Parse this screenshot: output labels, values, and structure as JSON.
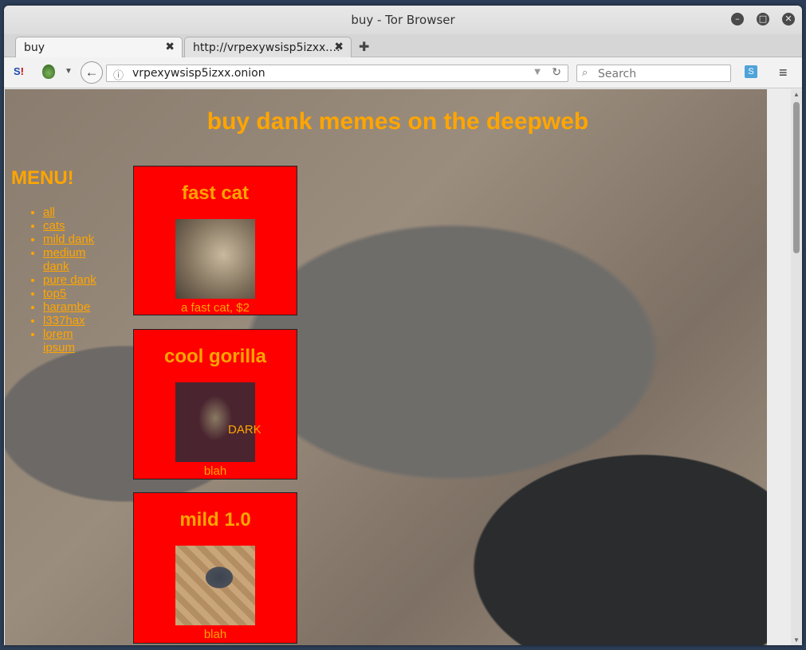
{
  "window": {
    "title": "buy - Tor Browser"
  },
  "tabs": [
    {
      "label": "buy",
      "close": "✖"
    },
    {
      "label": "http://vrpexywsisp5izxx.…",
      "close": "✖"
    }
  ],
  "toolbar": {
    "url": "vrpexywsisp5izxx.onion",
    "search_placeholder": "Search"
  },
  "page": {
    "title": "buy dank memes on the deepweb",
    "menu_heading": "MENU!",
    "menu": [
      "all",
      "cats",
      "mild dank",
      "medium dank",
      "pure dank",
      "top5",
      "harambe",
      "l337hax",
      "lorem ipsum"
    ],
    "products": [
      {
        "name": "fast cat",
        "caption": "a fast cat, $2",
        "overlay": ""
      },
      {
        "name": "cool gorilla",
        "caption": "blah",
        "overlay": "DARK"
      },
      {
        "name": "mild 1.0",
        "caption": "blah",
        "overlay": ""
      }
    ]
  },
  "colors": {
    "accent": "#ffa500",
    "card": "#ff0000"
  }
}
